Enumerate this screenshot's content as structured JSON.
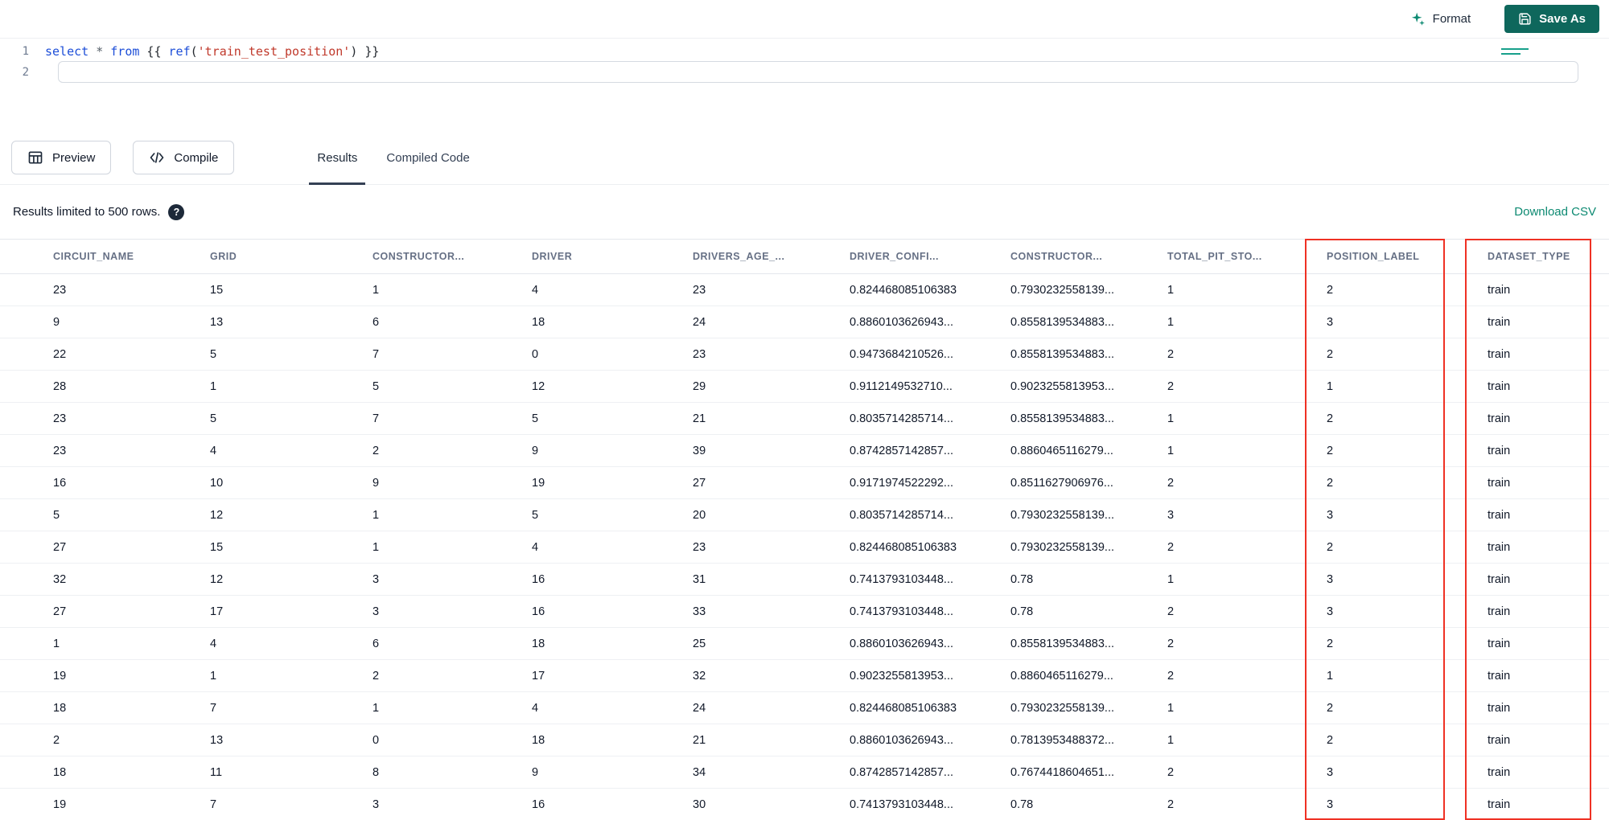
{
  "topbar": {
    "format_label": "Format",
    "save_as_label": "Save As"
  },
  "editor": {
    "lines": [
      {
        "number": "1",
        "tokens": [
          {
            "t": "select",
            "c": "keyword"
          },
          {
            "t": " ",
            "c": "plain"
          },
          {
            "t": "*",
            "c": "operator"
          },
          {
            "t": " ",
            "c": "plain"
          },
          {
            "t": "from",
            "c": "keyword"
          },
          {
            "t": " {{ ",
            "c": "plain"
          },
          {
            "t": "ref",
            "c": "function"
          },
          {
            "t": "(",
            "c": "plain"
          },
          {
            "t": "'train_test_position'",
            "c": "string"
          },
          {
            "t": ") }}",
            "c": "plain"
          }
        ]
      },
      {
        "number": "2",
        "tokens": []
      }
    ]
  },
  "toolbar": {
    "preview_label": "Preview",
    "compile_label": "Compile",
    "tabs": [
      {
        "label": "Results",
        "active": true
      },
      {
        "label": "Compiled Code",
        "active": false
      }
    ]
  },
  "results": {
    "limit_text": "Results limited to 500 rows.",
    "download_label": "Download CSV"
  },
  "icons": {
    "format": "sparkles-icon",
    "save_as": "floppy-disk-icon",
    "preview": "table-grid-icon",
    "compile": "code-brackets-icon",
    "help_glyph": "?"
  },
  "table": {
    "columns": [
      "CIRCUIT_NAME",
      "GRID",
      "CONSTRUCTOR...",
      "DRIVER",
      "DRIVERS_AGE_...",
      "DRIVER_CONFI...",
      "CONSTRUCTOR...",
      "TOTAL_PIT_STO...",
      "POSITION_LABEL",
      "DATASET_TYPE"
    ],
    "rows": [
      [
        "23",
        "15",
        "1",
        "4",
        "23",
        "0.824468085106383",
        "0.7930232558139...",
        "1",
        "2",
        "train"
      ],
      [
        "9",
        "13",
        "6",
        "18",
        "24",
        "0.8860103626943...",
        "0.8558139534883...",
        "1",
        "3",
        "train"
      ],
      [
        "22",
        "5",
        "7",
        "0",
        "23",
        "0.9473684210526...",
        "0.8558139534883...",
        "2",
        "2",
        "train"
      ],
      [
        "28",
        "1",
        "5",
        "12",
        "29",
        "0.9112149532710...",
        "0.9023255813953...",
        "2",
        "1",
        "train"
      ],
      [
        "23",
        "5",
        "7",
        "5",
        "21",
        "0.8035714285714...",
        "0.8558139534883...",
        "1",
        "2",
        "train"
      ],
      [
        "23",
        "4",
        "2",
        "9",
        "39",
        "0.8742857142857...",
        "0.8860465116279...",
        "1",
        "2",
        "train"
      ],
      [
        "16",
        "10",
        "9",
        "19",
        "27",
        "0.9171974522292...",
        "0.8511627906976...",
        "2",
        "2",
        "train"
      ],
      [
        "5",
        "12",
        "1",
        "5",
        "20",
        "0.8035714285714...",
        "0.7930232558139...",
        "3",
        "3",
        "train"
      ],
      [
        "27",
        "15",
        "1",
        "4",
        "23",
        "0.824468085106383",
        "0.7930232558139...",
        "2",
        "2",
        "train"
      ],
      [
        "32",
        "12",
        "3",
        "16",
        "31",
        "0.7413793103448...",
        "0.78",
        "1",
        "3",
        "train"
      ],
      [
        "27",
        "17",
        "3",
        "16",
        "33",
        "0.7413793103448...",
        "0.78",
        "2",
        "3",
        "train"
      ],
      [
        "1",
        "4",
        "6",
        "18",
        "25",
        "0.8860103626943...",
        "0.8558139534883...",
        "2",
        "2",
        "train"
      ],
      [
        "19",
        "1",
        "2",
        "17",
        "32",
        "0.9023255813953...",
        "0.8860465116279...",
        "2",
        "1",
        "train"
      ],
      [
        "18",
        "7",
        "1",
        "4",
        "24",
        "0.824468085106383",
        "0.7930232558139...",
        "1",
        "2",
        "train"
      ],
      [
        "2",
        "13",
        "0",
        "18",
        "21",
        "0.8860103626943...",
        "0.7813953488372...",
        "1",
        "2",
        "train"
      ],
      [
        "18",
        "11",
        "8",
        "9",
        "34",
        "0.8742857142857...",
        "0.7674418604651...",
        "2",
        "3",
        "train"
      ],
      [
        "19",
        "7",
        "3",
        "16",
        "30",
        "0.7413793103448...",
        "0.78",
        "2",
        "3",
        "train"
      ]
    ],
    "highlighted_columns": [
      "POSITION_LABEL",
      "DATASET_TYPE"
    ],
    "highlight_color": "#ef3124"
  },
  "colors": {
    "accent_teal": "#0d8a72",
    "save_button_bg": "#0e675c",
    "tab_underline": "#344054",
    "highlight_red": "#ef3124"
  }
}
